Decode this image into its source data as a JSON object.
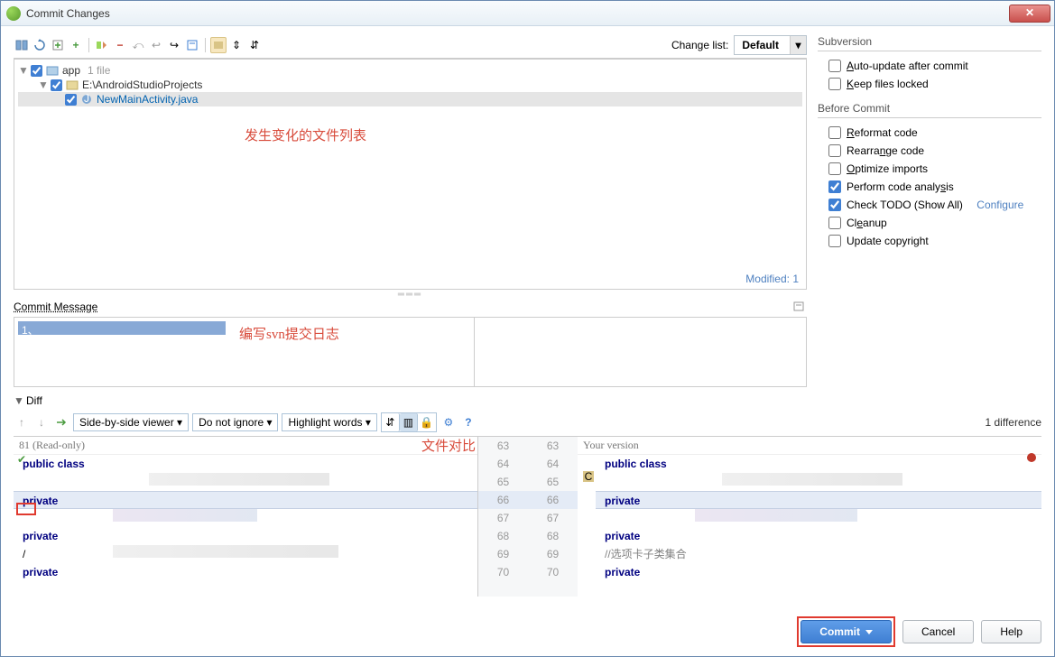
{
  "title": "Commit Changes",
  "toolbar": {
    "change_list_label": "Change list:",
    "change_list_value": "Default"
  },
  "tree": {
    "root": {
      "name": "app",
      "count": "1 file"
    },
    "path": {
      "name": "E:\\AndroidStudioProjects"
    },
    "file": {
      "name": "NewMainActivity.java"
    }
  },
  "modified_label": "Modified: 1",
  "anno": {
    "changed_files": "发生变化的文件列表",
    "commit_log": "编写svn提交日志",
    "diff": "文件对比"
  },
  "commit_message": {
    "label": "Commit Message",
    "text": "1、"
  },
  "subversion": {
    "header": "Subversion",
    "auto_update": "Auto-update after commit",
    "keep_locked": "Keep files locked"
  },
  "before_commit": {
    "header": "Before Commit",
    "reformat": "Reformat code",
    "rearrange": "Rearrange code",
    "optimize": "Optimize imports",
    "analysis": "Perform code analysis",
    "todo": "Check TODO (Show All)",
    "configure": "Configure",
    "cleanup": "Cleanup",
    "copyright": "Update copyright"
  },
  "diff": {
    "label": "Diff",
    "viewer_mode": "Side-by-side viewer",
    "ignore_mode": "Do not ignore",
    "highlight_mode": "Highlight words",
    "count": "1 difference",
    "left_title": "81 (Read-only)",
    "right_title": "Your version",
    "left_gutter": [
      "63",
      "64",
      "65",
      "66",
      "67",
      "68",
      "69",
      "70"
    ],
    "right_gutter": [
      "63",
      "64",
      "65",
      "66",
      "67",
      "68",
      "69",
      "70"
    ],
    "left_lines": [
      {
        "txt": "public class",
        "cls": "kw"
      },
      {
        "txt": "",
        "cls": ""
      },
      {
        "txt": "private",
        "cls": "kw",
        "hl": true
      },
      {
        "txt": "",
        "cls": ""
      },
      {
        "txt": "private",
        "cls": "kw"
      },
      {
        "txt": "/",
        "cls": ""
      },
      {
        "txt": "private",
        "cls": "kw"
      }
    ],
    "right_lines": [
      {
        "txt": "public class",
        "cls": "kw"
      },
      {
        "txt": "",
        "cls": ""
      },
      {
        "txt": "private",
        "cls": "kw",
        "hl": true
      },
      {
        "txt": "",
        "cls": ""
      },
      {
        "txt": "private",
        "cls": "kw"
      },
      {
        "txt": "//选项卡子类集合",
        "cls": "cmt"
      },
      {
        "txt": "private",
        "cls": "kw"
      }
    ]
  },
  "footer": {
    "commit": "Commit",
    "cancel": "Cancel",
    "help": "Help"
  }
}
